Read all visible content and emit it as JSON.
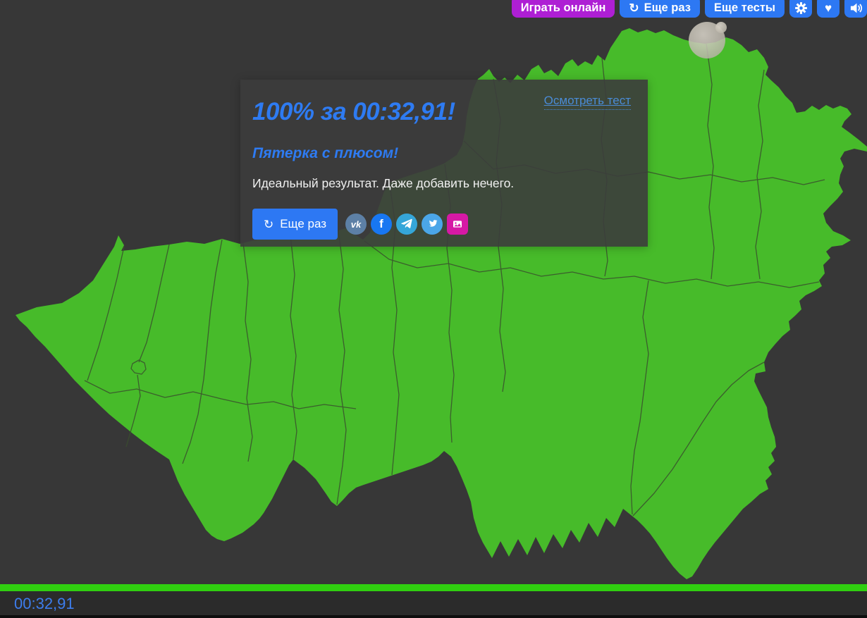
{
  "colors": {
    "background": "#373737",
    "map_green": "#47bb2a",
    "map_border": "#3a4f2e",
    "accent_blue": "#2d78f3",
    "magenta_button": "#ae1fd4",
    "share_magenta": "#d619a5",
    "progress_green": "#30cf10",
    "timer_blue": "#3d7ded",
    "link_blue": "#4a8bd6",
    "title_blue": "#2e7bf2"
  },
  "toolbar": {
    "play_online": "Играть онлайн",
    "again": "Еще раз",
    "more_tests": "Еще тесты"
  },
  "dialog": {
    "review_link": "Осмотреть тест",
    "title": "100% за 00:32,91!",
    "subtitle": "Пятерка с плюсом!",
    "message": "Идеальный результат. Даже добавить нечего.",
    "again": "Еще раз",
    "share_icons": [
      "vk",
      "facebook",
      "telegram",
      "twitter",
      "image"
    ]
  },
  "statusbar": {
    "time": "00:32,91",
    "progress_percent": 100
  },
  "glyphs": {
    "refresh": "↻",
    "heart": "♥",
    "vk": "vk",
    "facebook": "f"
  }
}
